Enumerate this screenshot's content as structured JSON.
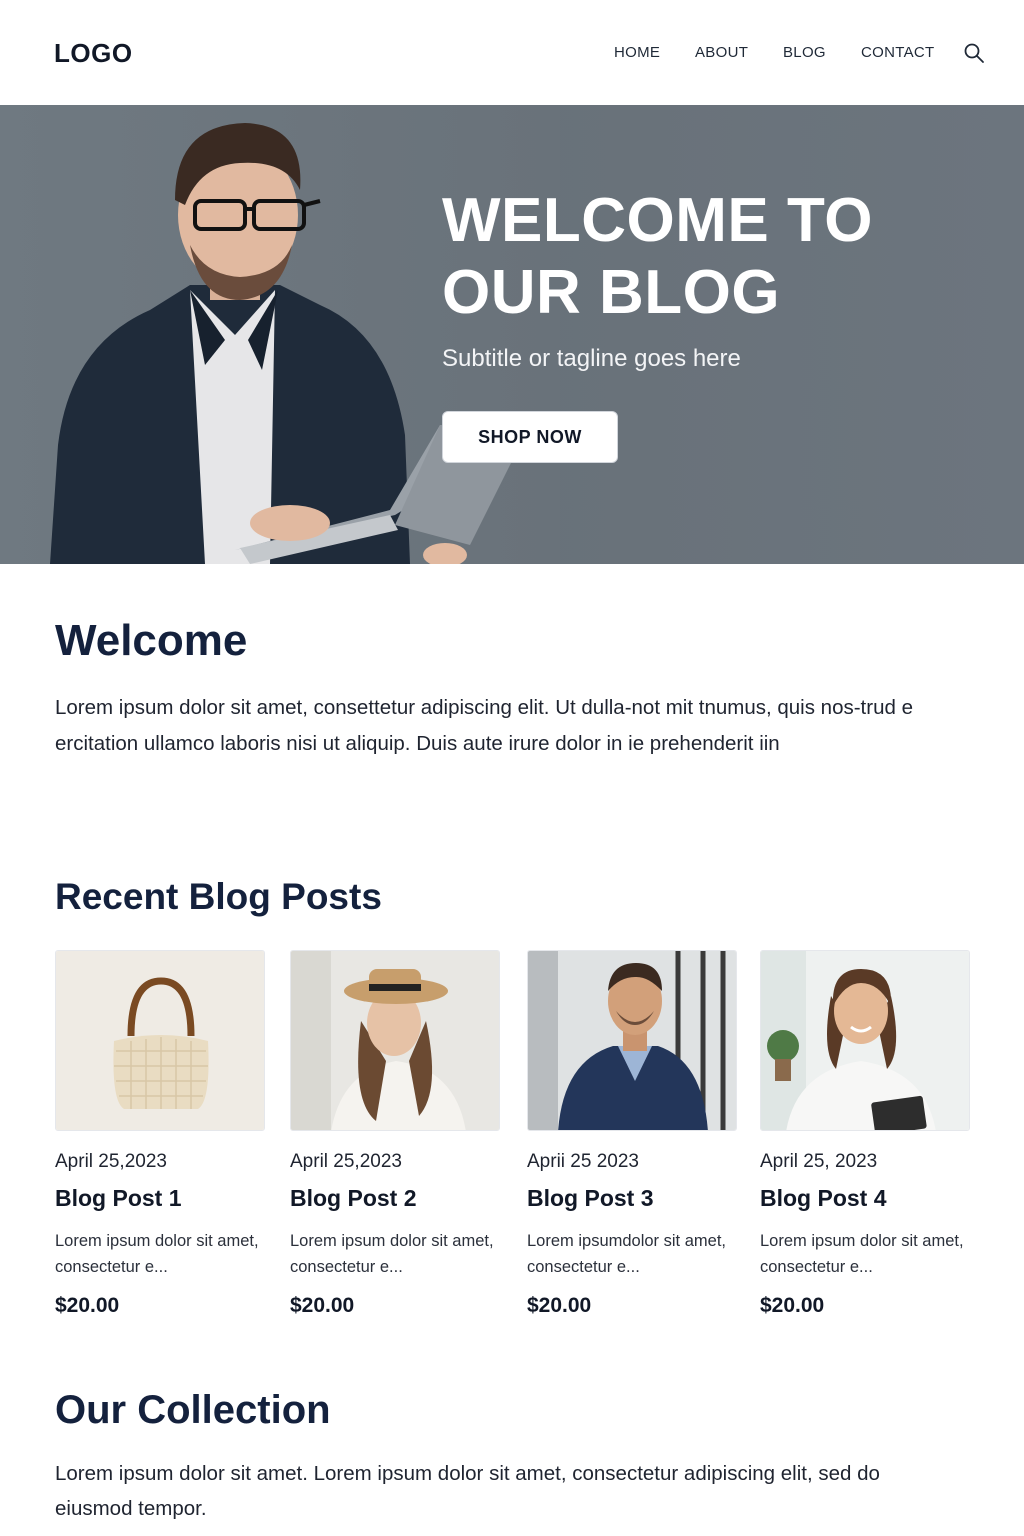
{
  "header": {
    "logo": "LOGO",
    "nav": [
      "HOME",
      "ABOUT",
      "BLOG",
      "CONTACT"
    ],
    "search_icon": "search-icon"
  },
  "hero": {
    "title_line1": "WELCOME TO",
    "title_line2": "OUR BLOG",
    "subtitle": "Subtitle or tagline goes here",
    "button": "SHOP NOW",
    "background_color": "#6b747d"
  },
  "welcome": {
    "title": "Welcome",
    "text": "Lorem ipsum dolor sit amet, consettetur adipiscing elit. Ut dulla-not mit tnumus, quis nos-trud e ercitation ullamco laboris nisi ut aliquip. Duis aute irure dolor in ie prehenderit iin"
  },
  "recent": {
    "title": "Recent Blog Posts",
    "posts": [
      {
        "date": "April 25,2023",
        "title": "Blog Post 1",
        "excerpt": "Lorem ipsum dolor sit amet, consectetur e...",
        "price": "$20.00",
        "image": "handbag"
      },
      {
        "date": "April 25,2023",
        "title": "Blog Post 2",
        "excerpt": "Lorem ipsum dolor sit amet, consectetur e...",
        "price": "$20.00",
        "image": "woman-hat"
      },
      {
        "date": "Aprii 25 2023",
        "title": "Blog Post 3",
        "excerpt": "Lorem ipsumdolor sit amet, consectetur e...",
        "price": "$20.00",
        "image": "man-suit"
      },
      {
        "date": "April 25, 2023",
        "title": "Blog Post 4",
        "excerpt": "Lorem ipsum dolor sit amet, consectetur e...",
        "price": "$20.00",
        "image": "woman-smiling"
      }
    ]
  },
  "collection": {
    "title": "Our Collection",
    "text": "Lorem ipsum dolor sit amet.  Lorem ipsum dolor sit amet, consectetur  adipiscing elit, sed do eiusmod tempor."
  },
  "colors": {
    "heading": "#14213d",
    "hero_bg": "#6b747d",
    "button_bg": "#ffffff"
  }
}
